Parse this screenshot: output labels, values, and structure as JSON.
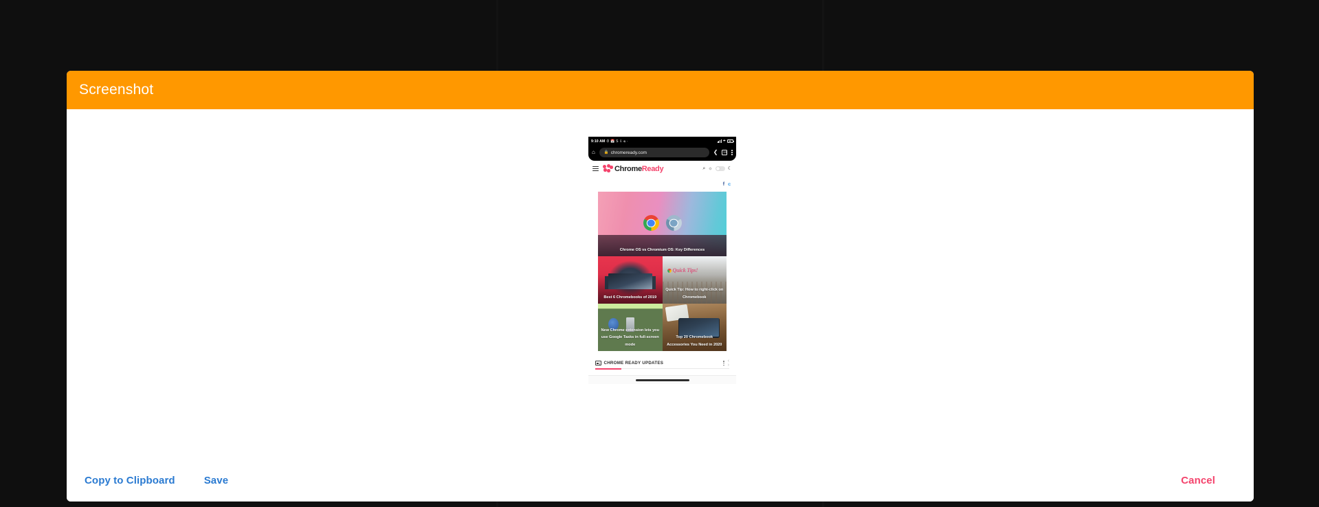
{
  "theme": {
    "backdrop": "#0f0f0f",
    "header_orange": "#ff9800",
    "link_blue": "#2a7ad1",
    "cancel_pink": "#f4436c",
    "brand_pink": "#f4436c"
  },
  "dialog": {
    "title": "Screenshot",
    "footer": {
      "copy_label": "Copy to Clipboard",
      "save_label": "Save",
      "cancel_label": "Cancel"
    }
  },
  "preview": {
    "status_bar": {
      "clock": "9:10 AM",
      "notification_icons": [
        "alarm-off-icon",
        "calendar-icon",
        "s-icon",
        "download-icon",
        "twitter-icon",
        "dot-icon"
      ],
      "right_icons": [
        "signal-bars-icon",
        "wifi-icon",
        "battery-icon"
      ]
    },
    "browser": {
      "home_icon": "home-icon",
      "lock_icon": "lock-icon",
      "url": "chromeready.com",
      "share_icon": "share-icon",
      "tab_count": "13",
      "menu_icon": "kebab-menu-icon"
    },
    "site_header": {
      "menu_icon": "hamburger-menu-icon",
      "brand_part1": "Chrome",
      "brand_part2": "Ready",
      "logo_icon": "chromeready-dots-logo",
      "search_icon": "search-icon",
      "sun_icon": "sun-icon",
      "moon_icon": "moon-icon",
      "theme_toggle": "theme-toggle"
    },
    "social": {
      "facebook_glyph": "f",
      "twitter_glyph": "ᴠ"
    },
    "cards": [
      {
        "title": "Chrome OS vs Chromium OS: Key Differences",
        "style": "hero",
        "logos": [
          "chrome-logo",
          "chromium-logo"
        ]
      },
      {
        "title": "Best 6 Chromebooks of 2019",
        "style": "chromebooks"
      },
      {
        "title": "Quick Tip: How to right-click on Chromebook",
        "style": "quicktip",
        "overlay_script": "Quick Tips!"
      },
      {
        "title": "New Chrome extension lets you use Google Tasks in full-screen mode",
        "style": "extension"
      },
      {
        "title": "Top 20 Chromebook Accessories You Need in 2020",
        "style": "accessories"
      }
    ],
    "updates": {
      "icon": "news-icon",
      "label": "CHROME READY UPDATES",
      "menu_icon": "kebab-menu-icon",
      "prev_icon": "chevron-up-icon",
      "next_icon": "chevron-down-icon"
    },
    "gesture_bar": "home-gesture-bar"
  }
}
